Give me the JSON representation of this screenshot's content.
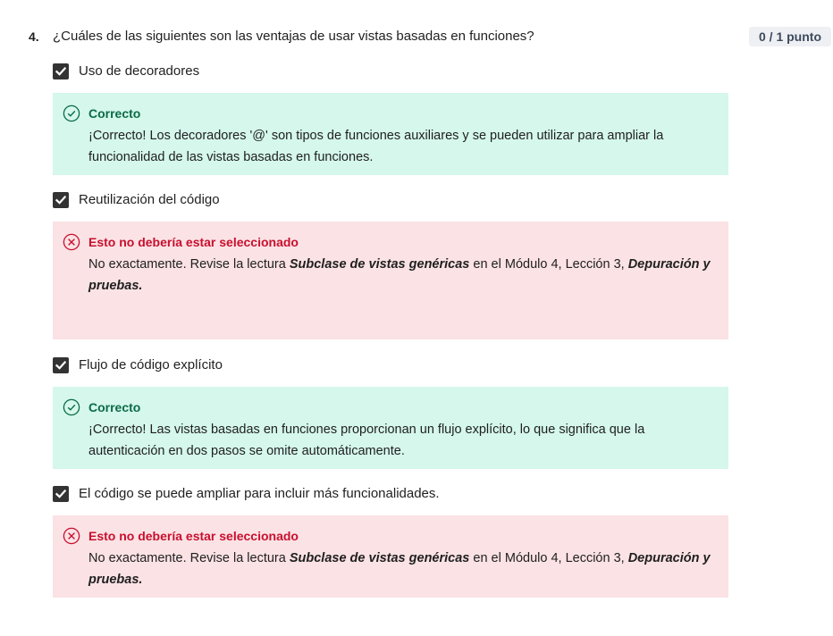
{
  "question": {
    "number": "4.",
    "text": "¿Cuáles de las siguientes son las ventajas de usar vistas basadas en funciones?",
    "score": "0 / 1 punto"
  },
  "options": [
    {
      "label": "Uso de decoradores",
      "checked": true,
      "feedback": {
        "status": "correct",
        "title": "Correcto",
        "text": "¡Correcto! Los decoradores '@' son tipos de funciones auxiliares y se pueden utilizar para ampliar la funcionalidad de las vistas basadas en funciones."
      }
    },
    {
      "label": "Reutilización del código",
      "checked": true,
      "feedback": {
        "status": "incorrect",
        "title": "Esto no debería estar seleccionado",
        "text_before": "No exactamente. Revise la lectura ",
        "emph1": "Subclase de vistas genéricas",
        "text_middle": " en el Módulo 4, Lección 3, ",
        "emph2": "Depuración y pruebas."
      }
    },
    {
      "label": "Flujo de código explícito",
      "checked": true,
      "feedback": {
        "status": "correct",
        "title": "Correcto",
        "text": "¡Correcto! Las vistas basadas en funciones proporcionan un flujo explícito, lo que significa que la autenticación en dos pasos se omite automáticamente."
      }
    },
    {
      "label": "El código se puede ampliar para incluir más funcionalidades.",
      "checked": true,
      "feedback": {
        "status": "incorrect",
        "title": "Esto no debería estar seleccionado",
        "text_before": "No exactamente. Revise la lectura ",
        "emph1": "Subclase de vistas genéricas",
        "text_middle": " en el Módulo 4, Lección 3, ",
        "emph2": "Depuración y pruebas."
      }
    }
  ],
  "icons": {
    "checkbox": "checkmark-icon",
    "correct": "check-circle-icon",
    "incorrect": "x-circle-icon"
  },
  "colors": {
    "correct_bg": "#d5f7ec",
    "correct_text": "#0b6b47",
    "incorrect_bg": "#fbe2e5",
    "incorrect_text": "#c8102e",
    "checkbox": "#333333"
  }
}
